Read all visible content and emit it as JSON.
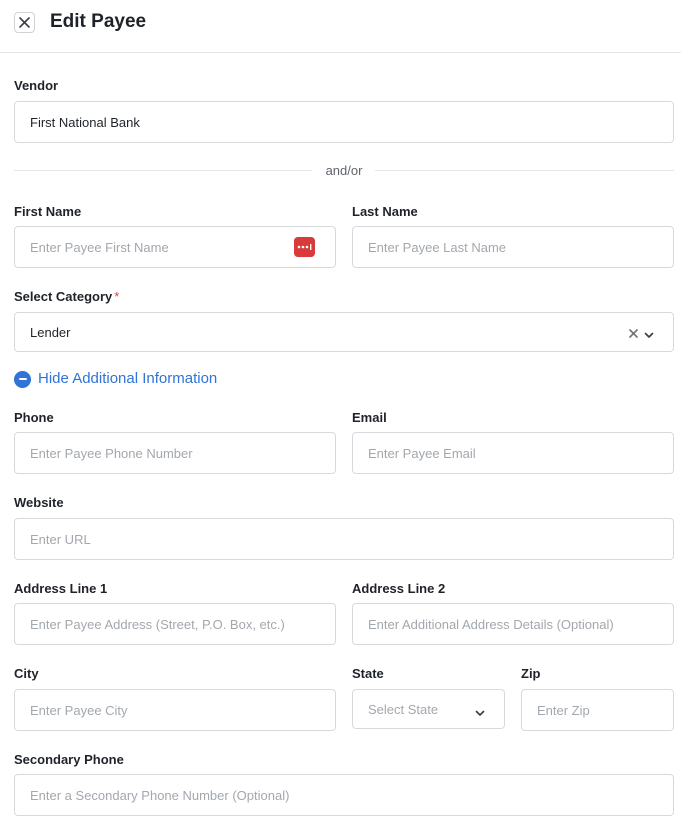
{
  "header": {
    "title": "Edit Payee"
  },
  "vendor": {
    "label": "Vendor",
    "value": "First National Bank"
  },
  "separator": "and/or",
  "first_name": {
    "label": "First Name",
    "placeholder": "Enter Payee First Name"
  },
  "last_name": {
    "label": "Last Name",
    "placeholder": "Enter Payee Last Name"
  },
  "category": {
    "label": "Select Category",
    "required_mark": "*",
    "value": "Lender"
  },
  "toggle": {
    "label": "Hide Additional Information"
  },
  "phone": {
    "label": "Phone",
    "placeholder": "Enter Payee Phone Number"
  },
  "email": {
    "label": "Email",
    "placeholder": "Enter Payee Email"
  },
  "website": {
    "label": "Website",
    "placeholder": "Enter URL"
  },
  "address1": {
    "label": "Address Line 1",
    "placeholder": "Enter Payee Address (Street, P.O. Box, etc.)"
  },
  "address2": {
    "label": "Address Line 2",
    "placeholder": "Enter Additional Address Details (Optional)"
  },
  "city": {
    "label": "City",
    "placeholder": "Enter Payee City"
  },
  "state": {
    "label": "State",
    "placeholder": "Select State"
  },
  "zip": {
    "label": "Zip",
    "placeholder": "Enter Zip"
  },
  "secondary_phone": {
    "label": "Secondary Phone",
    "placeholder": "Enter a Secondary Phone Number (Optional)"
  },
  "colors": {
    "accent": "#2f74d6",
    "required": "#d64545",
    "password_manager": "#d93a3a"
  },
  "icons": {
    "close": "close-icon",
    "password_manager": "password-manager-icon",
    "clear": "clear-icon",
    "chevron": "chevron-down-icon",
    "toggle": "minus-circle-icon"
  }
}
